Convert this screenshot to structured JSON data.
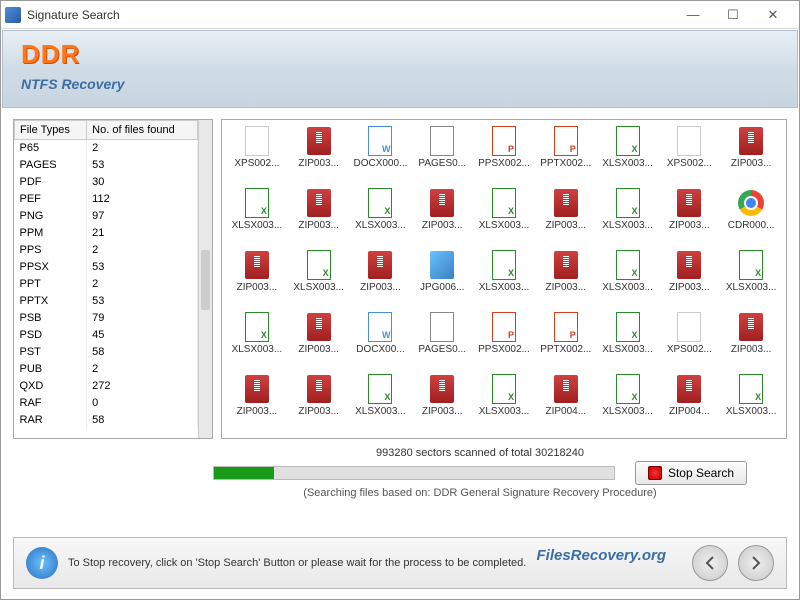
{
  "titlebar": {
    "title": "Signature Search"
  },
  "banner": {
    "logo": "DDR",
    "subtitle": "NTFS Recovery"
  },
  "fileTypesTable": {
    "headers": [
      "File Types",
      "No. of files found"
    ],
    "rows": [
      {
        "t": "P65",
        "n": "2"
      },
      {
        "t": "PAGES",
        "n": "53"
      },
      {
        "t": "PDF",
        "n": "30"
      },
      {
        "t": "PEF",
        "n": "112"
      },
      {
        "t": "PNG",
        "n": "97"
      },
      {
        "t": "PPM",
        "n": "21"
      },
      {
        "t": "PPS",
        "n": "2"
      },
      {
        "t": "PPSX",
        "n": "53"
      },
      {
        "t": "PPT",
        "n": "2"
      },
      {
        "t": "PPTX",
        "n": "53"
      },
      {
        "t": "PSB",
        "n": "79"
      },
      {
        "t": "PSD",
        "n": "45"
      },
      {
        "t": "PST",
        "n": "58"
      },
      {
        "t": "PUB",
        "n": "2"
      },
      {
        "t": "QXD",
        "n": "272"
      },
      {
        "t": "RAF",
        "n": "0"
      },
      {
        "t": "RAR",
        "n": "58"
      }
    ]
  },
  "files": [
    {
      "label": "XPS002...",
      "icon": "blank"
    },
    {
      "label": "ZIP003...",
      "icon": "zip"
    },
    {
      "label": "DOCX000...",
      "icon": "doc"
    },
    {
      "label": "PAGES0...",
      "icon": "pages"
    },
    {
      "label": "PPSX002...",
      "icon": "ppt"
    },
    {
      "label": "PPTX002...",
      "icon": "ppt"
    },
    {
      "label": "XLSX003...",
      "icon": "xls"
    },
    {
      "label": "XPS002...",
      "icon": "blank"
    },
    {
      "label": "ZIP003...",
      "icon": "zip"
    },
    {
      "label": "XLSX003...",
      "icon": "xls"
    },
    {
      "label": "ZIP003...",
      "icon": "zip"
    },
    {
      "label": "XLSX003...",
      "icon": "xls"
    },
    {
      "label": "ZIP003...",
      "icon": "zip"
    },
    {
      "label": "XLSX003...",
      "icon": "xls"
    },
    {
      "label": "ZIP003...",
      "icon": "zip"
    },
    {
      "label": "XLSX003...",
      "icon": "xls"
    },
    {
      "label": "ZIP003...",
      "icon": "zip"
    },
    {
      "label": "CDR000...",
      "icon": "chrome"
    },
    {
      "label": "ZIP003...",
      "icon": "zip"
    },
    {
      "label": "XLSX003...",
      "icon": "xls"
    },
    {
      "label": "ZIP003...",
      "icon": "zip"
    },
    {
      "label": "JPG006...",
      "icon": "jpg"
    },
    {
      "label": "XLSX003...",
      "icon": "xls"
    },
    {
      "label": "ZIP003...",
      "icon": "zip"
    },
    {
      "label": "XLSX003...",
      "icon": "xls"
    },
    {
      "label": "ZIP003...",
      "icon": "zip"
    },
    {
      "label": "XLSX003...",
      "icon": "xls"
    },
    {
      "label": "XLSX003...",
      "icon": "xls"
    },
    {
      "label": "ZIP003...",
      "icon": "zip"
    },
    {
      "label": "DOCX00...",
      "icon": "doc"
    },
    {
      "label": "PAGES0...",
      "icon": "pages"
    },
    {
      "label": "PPSX002...",
      "icon": "ppt"
    },
    {
      "label": "PPTX002...",
      "icon": "ppt"
    },
    {
      "label": "XLSX003...",
      "icon": "xls"
    },
    {
      "label": "XPS002...",
      "icon": "blank"
    },
    {
      "label": "ZIP003...",
      "icon": "zip"
    },
    {
      "label": "ZIP003...",
      "icon": "zip"
    },
    {
      "label": "ZIP003...",
      "icon": "zip"
    },
    {
      "label": "XLSX003...",
      "icon": "xls"
    },
    {
      "label": "ZIP003...",
      "icon": "zip"
    },
    {
      "label": "XLSX003...",
      "icon": "xls"
    },
    {
      "label": "ZIP004...",
      "icon": "zip"
    },
    {
      "label": "XLSX003...",
      "icon": "xls"
    },
    {
      "label": "ZIP004...",
      "icon": "zip"
    },
    {
      "label": "XLSX003...",
      "icon": "xls"
    }
  ],
  "progress": {
    "label": "993280 sectors scanned of total 30218240",
    "sub": "(Searching files based on:  DDR General Signature Recovery Procedure)",
    "stopLabel": "Stop Search"
  },
  "footer": {
    "text": "To Stop recovery, click on 'Stop Search' Button or please wait for the process to be completed.",
    "brand": "FilesRecovery.org"
  }
}
